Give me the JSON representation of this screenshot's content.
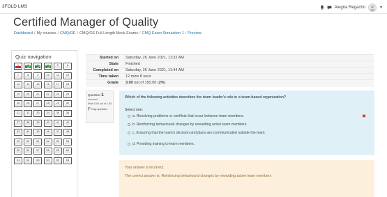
{
  "app": {
    "brand": "3FOLD LMS"
  },
  "user": {
    "name": "Alegria Regacho"
  },
  "page": {
    "title": "Certified Manager of Quality"
  },
  "breadcrumb": [
    {
      "label": "Dashboard",
      "link": true
    },
    {
      "label": "My courses",
      "link": false
    },
    {
      "label": "CMQ/OE",
      "link": true
    },
    {
      "label": "CMQ/OE Full Length Mock Exams",
      "link": false
    },
    {
      "label": "CMQ Exam Simulation 1",
      "link": true
    },
    {
      "label": "Preview",
      "link": true
    }
  ],
  "quiz_nav": {
    "title": "Quiz navigation",
    "questions": [
      {
        "n": "1",
        "state": "incorrect-current"
      },
      {
        "n": "2",
        "state": "correct"
      },
      {
        "n": "3",
        "state": "correct"
      },
      {
        "n": "4",
        "state": "correct"
      },
      {
        "n": "5",
        "state": "none"
      },
      {
        "n": "6",
        "state": "none"
      },
      {
        "n": "7",
        "state": "none"
      },
      {
        "n": "8",
        "state": "none"
      },
      {
        "n": "9",
        "state": "none"
      },
      {
        "n": "10",
        "state": "none"
      },
      {
        "n": "11",
        "state": "none"
      },
      {
        "n": "12",
        "state": "none"
      },
      {
        "n": "13",
        "state": "none"
      },
      {
        "n": "14",
        "state": "none"
      },
      {
        "n": "15",
        "state": "none"
      },
      {
        "n": "16",
        "state": "none"
      },
      {
        "n": "17",
        "state": "none"
      },
      {
        "n": "18",
        "state": "none"
      },
      {
        "n": "19",
        "state": "none"
      },
      {
        "n": "20",
        "state": "none"
      },
      {
        "n": "21",
        "state": "none"
      },
      {
        "n": "22",
        "state": "none"
      },
      {
        "n": "23",
        "state": "none"
      },
      {
        "n": "24",
        "state": "none"
      },
      {
        "n": "25",
        "state": "none"
      },
      {
        "n": "26",
        "state": "none"
      },
      {
        "n": "27",
        "state": "none"
      },
      {
        "n": "28",
        "state": "none"
      },
      {
        "n": "29",
        "state": "none"
      },
      {
        "n": "30",
        "state": "none"
      },
      {
        "n": "31",
        "state": "none"
      },
      {
        "n": "32",
        "state": "none"
      },
      {
        "n": "33",
        "state": "none"
      },
      {
        "n": "34",
        "state": "none"
      },
      {
        "n": "35",
        "state": "none"
      },
      {
        "n": "36",
        "state": "none"
      },
      {
        "n": "37",
        "state": "none"
      },
      {
        "n": "38",
        "state": "none"
      },
      {
        "n": "39",
        "state": "none"
      },
      {
        "n": "40",
        "state": "none"
      },
      {
        "n": "41",
        "state": "none"
      },
      {
        "n": "42",
        "state": "none"
      },
      {
        "n": "43",
        "state": "none"
      },
      {
        "n": "44",
        "state": "none"
      },
      {
        "n": "45",
        "state": "none"
      },
      {
        "n": "46",
        "state": "none"
      },
      {
        "n": "47",
        "state": "none"
      },
      {
        "n": "48",
        "state": "none"
      },
      {
        "n": "49",
        "state": "none"
      },
      {
        "n": "50",
        "state": "none"
      },
      {
        "n": "51",
        "state": "none"
      },
      {
        "n": "52",
        "state": "none"
      },
      {
        "n": "53",
        "state": "none"
      },
      {
        "n": "54",
        "state": "none"
      },
      {
        "n": "55",
        "state": "none"
      },
      {
        "n": "56",
        "state": "none"
      },
      {
        "n": "57",
        "state": "none"
      },
      {
        "n": "58",
        "state": "none"
      },
      {
        "n": "59",
        "state": "none"
      },
      {
        "n": "60",
        "state": "none"
      },
      {
        "n": "61",
        "state": "none"
      },
      {
        "n": "62",
        "state": "none"
      },
      {
        "n": "63",
        "state": "none"
      },
      {
        "n": "64",
        "state": "none"
      },
      {
        "n": "65",
        "state": "none"
      },
      {
        "n": "66",
        "state": "none"
      }
    ]
  },
  "summary": {
    "rows": [
      {
        "key": "Started on",
        "value": "Saturday, 26 June 2021, 11:32 AM"
      },
      {
        "key": "State",
        "value": "Finished"
      },
      {
        "key": "Completed on",
        "value": "Saturday, 26 June 2021, 11:44 AM"
      },
      {
        "key": "Time taken",
        "value": "12 mins 8 secs"
      }
    ],
    "grade_key": "Grade",
    "grade_strong": "3.00",
    "grade_mid": " out of 150.00 (",
    "grade_pct": "2%",
    "grade_end": ")"
  },
  "question": {
    "label": "Question",
    "number": "1",
    "status": "Incorrect",
    "mark": "Mark 0.00 out of 1.00",
    "flag_label": "Flag question",
    "text": "Which of the following activities describes the team leader's role in a team-based organization?",
    "select_one": "Select one:",
    "options": [
      "a. Resolving problems or conflicts that occur between team members.",
      "b. Reinforcing behavioural changes by rewarding active team members",
      "c. Ensuring that the team's decision and plans are communicated outside the team",
      "d. Providing training to team members."
    ]
  },
  "feedback": {
    "incorrect": "Your answer is incorrect.",
    "correct": "The correct answer is: Reinforcing behavioural changes by rewarding active team members"
  },
  "colors": {
    "link": "#1a73b0",
    "correct": "#2e8b2e",
    "incorrect": "#c62828",
    "question_bg": "#dff1f6",
    "feedback_bg": "#fcefdc"
  }
}
